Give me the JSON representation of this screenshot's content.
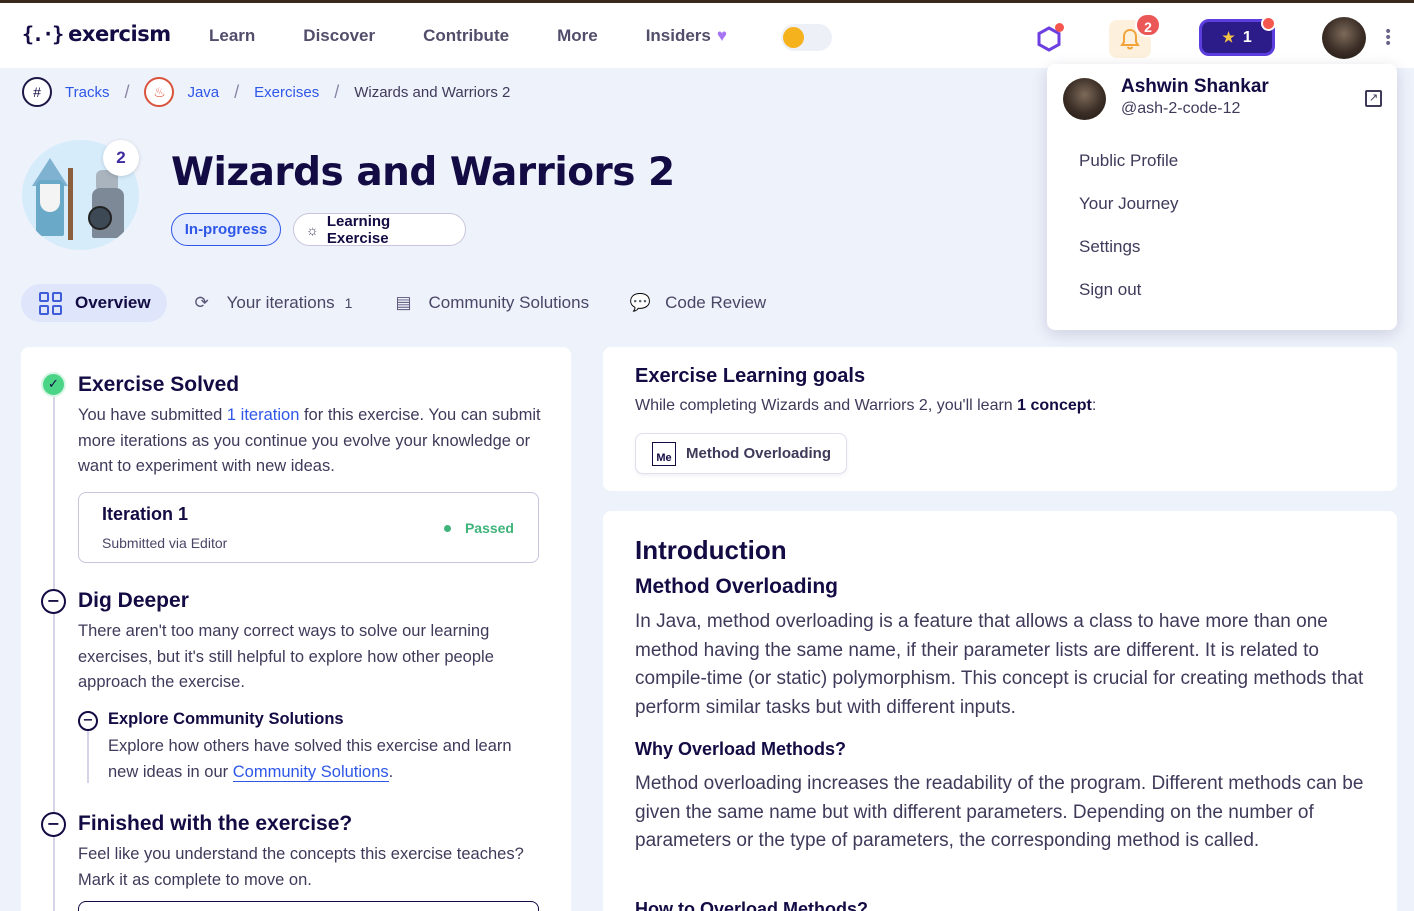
{
  "header": {
    "logo_mark": "{.·}",
    "logo_text": "exercism",
    "nav": [
      "Learn",
      "Discover",
      "Contribute",
      "More",
      "Insiders"
    ],
    "insiders_icon": "heart-icon",
    "notifications_count": "2",
    "reputation": "1",
    "accent": "#5c3ddd"
  },
  "breadcrumb": {
    "items": [
      "Tracks",
      "Java",
      "Exercises"
    ],
    "current": "Wizards and Warriors 2"
  },
  "exercise": {
    "title": "Wizards and Warriors 2",
    "iteration_badge": "2",
    "status_pill": "In-progress",
    "type_pill": "Learning Exercise"
  },
  "tabs": [
    {
      "label": "Overview",
      "icon": "overview-grid-icon"
    },
    {
      "label": "Your iterations",
      "icon": "iterations-icon",
      "count": "1"
    },
    {
      "label": "Community Solutions",
      "icon": "community-solutions-icon"
    },
    {
      "label": "Code Review",
      "icon": "code-review-icon"
    }
  ],
  "left": {
    "solved": {
      "title": "Exercise Solved",
      "text_before": "You have submitted ",
      "link": "1 iteration",
      "text_after": " for this exercise. You can submit more iterations as you continue you evolve your knowledge or want to experiment with new ideas."
    },
    "iteration": {
      "title": "Iteration 1",
      "sub": "Submitted via Editor",
      "status": "Passed"
    },
    "dig": {
      "title": "Dig Deeper",
      "text": "There aren't too many correct ways to solve our learning exercises, but it's still helpful to explore how other people approach the exercise."
    },
    "explore": {
      "title": "Explore Community Solutions",
      "text_before": "Explore how others have solved this exercise and learn new ideas in our ",
      "link": "Community Solutions",
      "text_after": "."
    },
    "finished": {
      "title": "Finished with the exercise?",
      "text": "Feel like you understand the concepts this exercise teaches? Mark it as complete to move on."
    }
  },
  "goals": {
    "title": "Exercise Learning goals",
    "text_before": "While completing Wizards and Warriors 2, you'll learn ",
    "count": "1 concept",
    "text_after": ":",
    "concept_abbr": "Me",
    "concept": "Method Overloading"
  },
  "intro": {
    "h2": "Introduction",
    "h3": "Method Overloading",
    "p1": "In Java, method overloading is a feature that allows a class to have more than one method having the same name, if their parameter lists are different. It is related to compile-time (or static) polymorphism. This concept is crucial for creating methods that perform similar tasks but with different inputs.",
    "h4": "Why Overload Methods?",
    "p2": "Method overloading increases the readability of the program. Different methods can be given the same name but with different parameters. Depending on the number of parameters or the type of parameters, the corresponding method is called.",
    "h4b": "How to Overload Methods?"
  },
  "user_menu": {
    "name": "Ashwin Shankar",
    "handle": "@ash-2-code-12",
    "items": [
      "Public Profile",
      "Your Journey",
      "Settings",
      "Sign out"
    ]
  }
}
